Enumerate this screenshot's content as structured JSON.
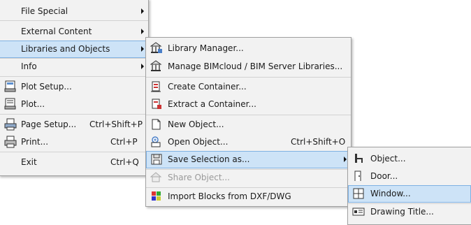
{
  "menu1": {
    "items": [
      {
        "label": "File Special",
        "has_submenu": true
      },
      {
        "label": "External Content",
        "has_submenu": true
      },
      {
        "label": "Libraries and Objects",
        "has_submenu": true,
        "highlighted": true
      },
      {
        "label": "Info",
        "has_submenu": true
      },
      {
        "label": "Plot Setup..."
      },
      {
        "label": "Plot..."
      },
      {
        "label": "Page Setup...",
        "shortcut": "Ctrl+Shift+P"
      },
      {
        "label": "Print...",
        "shortcut": "Ctrl+P"
      },
      {
        "label": "Exit",
        "shortcut": "Ctrl+Q"
      }
    ]
  },
  "menu2": {
    "items": [
      {
        "label": "Library Manager...",
        "icon": "library-manager-icon"
      },
      {
        "label": "Manage BIMcloud / BIM Server Libraries...",
        "icon": "bimcloud-libraries-icon"
      },
      {
        "label": "Create Container...",
        "icon": "create-container-icon"
      },
      {
        "label": "Extract a Container...",
        "icon": "extract-container-icon"
      },
      {
        "label": "New Object...",
        "icon": "new-object-icon"
      },
      {
        "label": "Open Object...",
        "shortcut": "Ctrl+Shift+O",
        "icon": "open-object-icon"
      },
      {
        "label": "Save Selection as...",
        "icon": "save-selection-icon",
        "highlighted": true,
        "has_submenu": true
      },
      {
        "label": "Share Object...",
        "icon": "share-object-icon",
        "disabled": true
      },
      {
        "label": "Import Blocks from DXF/DWG",
        "icon": "import-blocks-icon"
      }
    ]
  },
  "menu3": {
    "items": [
      {
        "label": "Object...",
        "icon": "object-icon"
      },
      {
        "label": "Door...",
        "icon": "door-icon"
      },
      {
        "label": "Window...",
        "icon": "window-icon",
        "highlighted": true
      },
      {
        "label": "Drawing Title...",
        "icon": "drawing-title-icon"
      }
    ]
  }
}
